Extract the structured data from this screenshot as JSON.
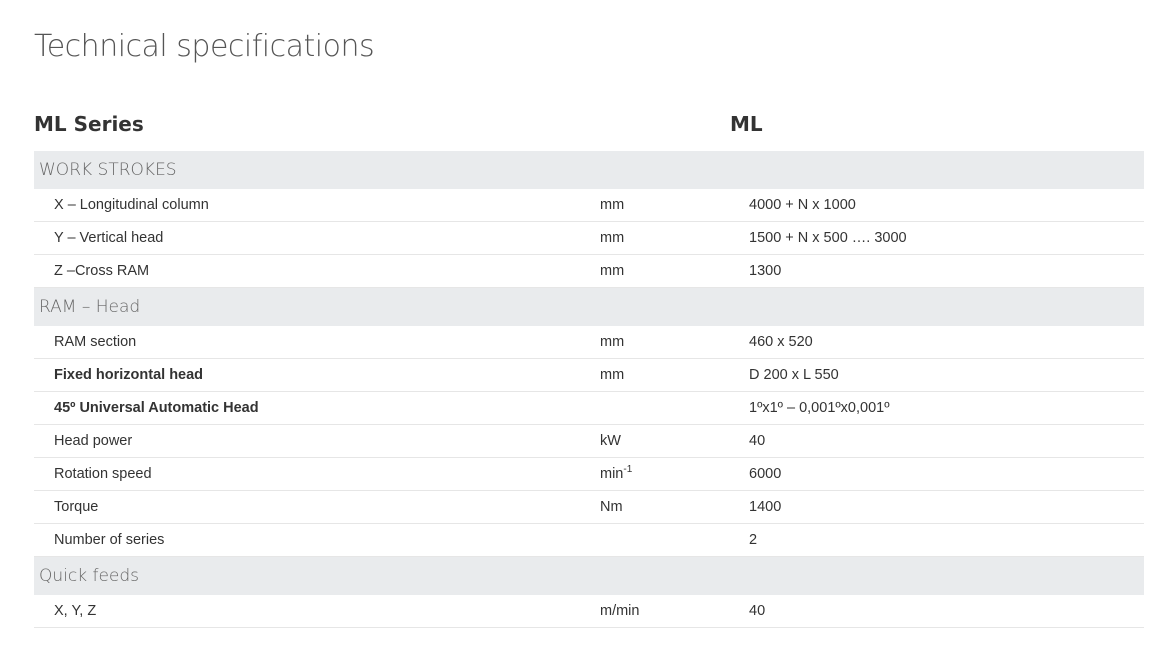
{
  "page": {
    "title": "Technical specifications"
  },
  "header": {
    "series_name": "ML Series",
    "model_name": "ML"
  },
  "sections": [
    {
      "title": "WORK STROKES",
      "rows": [
        {
          "label": "X – Longitudinal column",
          "unit": "mm",
          "value": "4000 + N x 1000"
        },
        {
          "label": "Y – Vertical head",
          "unit": "mm",
          "value": "1500 + N x 500 …. 3000"
        },
        {
          "label": "Z –Cross RAM",
          "unit": "mm",
          "value": "1300"
        }
      ]
    },
    {
      "title": "RAM – Head",
      "rows": [
        {
          "label": "RAM section",
          "unit": "mm",
          "value": "460 x 520"
        },
        {
          "label": "Fixed horizontal head",
          "unit": "mm",
          "value": "D 200 x L 550"
        },
        {
          "label": "45º Universal Automatic Head",
          "unit": "",
          "value": "1ºx1º – 0,001ºx0,001º"
        },
        {
          "label": "Head power",
          "unit": "kW",
          "value": "40"
        },
        {
          "label": "Rotation speed",
          "unit": "min",
          "unit_sup": "-1",
          "value": "6000"
        },
        {
          "label": "Torque",
          "unit": "Nm",
          "value": "1400"
        },
        {
          "label": "Number of series",
          "unit": "",
          "value": "2"
        }
      ]
    },
    {
      "title": "Quick feeds",
      "rows": [
        {
          "label": "X, Y, Z",
          "unit": "m/min",
          "value": "40"
        }
      ]
    }
  ]
}
